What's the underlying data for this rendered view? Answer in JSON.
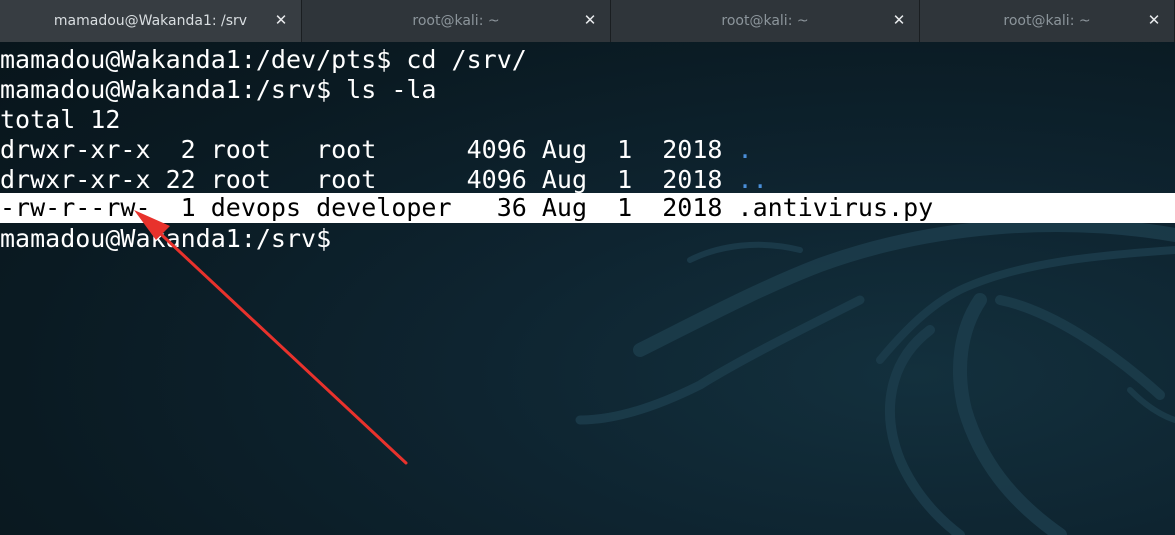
{
  "tabs": [
    {
      "label": "mamadou@Wakanda1: /srv",
      "active": true,
      "close": "✕"
    },
    {
      "label": "root@kali: ~",
      "active": false,
      "close": "✕"
    },
    {
      "label": "root@kali: ~",
      "active": false,
      "close": "✕"
    },
    {
      "label": "root@kali: ~",
      "active": false,
      "close": "✕"
    }
  ],
  "terminal": {
    "lines": [
      {
        "text": "mamadou@Wakanda1:/dev/pts$ cd /srv/"
      },
      {
        "text": "mamadou@Wakanda1:/srv$ ls -la"
      },
      {
        "text": "total 12"
      },
      {
        "prefix": "drwxr-xr-x  2 root   root      4096 Aug  1  2018 ",
        "name": "."
      },
      {
        "prefix": "drwxr-xr-x 22 root   root      4096 Aug  1  2018 ",
        "name": ".."
      },
      {
        "text": "-rw-r--rw-  1 devops developer   36 Aug  1  2018 .antivirus.py"
      },
      {
        "text": "mamadou@Wakanda1:/srv$ "
      }
    ]
  },
  "colors": {
    "directory_name": "#4a8fd9",
    "highlight_bg": "#ffffff",
    "annotation_arrow": "#e8322c"
  }
}
